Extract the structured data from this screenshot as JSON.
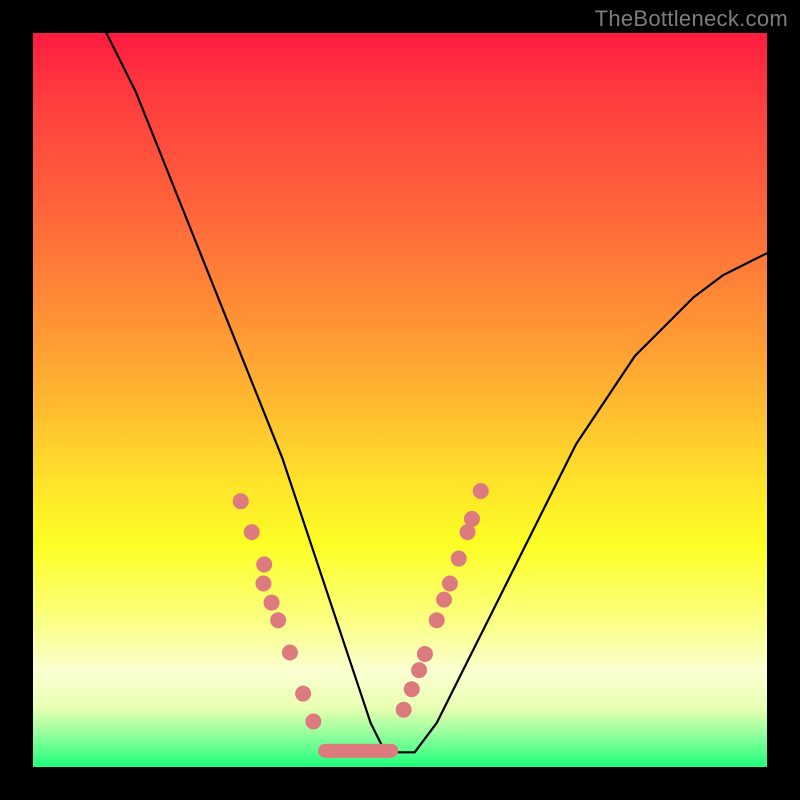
{
  "watermark": "TheBottleneck.com",
  "chart_data": {
    "type": "line",
    "title": "",
    "xlabel": "",
    "ylabel": "",
    "xlim": [
      0,
      100
    ],
    "ylim": [
      0,
      100
    ],
    "curve": {
      "name": "bottleneck-curve",
      "x": [
        10,
        14,
        18,
        22,
        26,
        30,
        34,
        36,
        38,
        40,
        42,
        44,
        46,
        48,
        52,
        55,
        58,
        62,
        66,
        70,
        74,
        78,
        82,
        86,
        90,
        94,
        98,
        100
      ],
      "y": [
        100,
        92,
        82,
        72,
        62,
        52,
        42,
        36,
        30,
        24,
        18,
        12,
        6,
        2,
        2,
        6,
        12,
        20,
        28,
        36,
        44,
        50,
        56,
        60,
        64,
        67,
        69,
        70
      ]
    },
    "markers_left": {
      "name": "left-cluster",
      "color": "#dd7a7e",
      "x": [
        28.3,
        29.8,
        31.5,
        31.4,
        32.5,
        33.4,
        35.0,
        36.8,
        38.2
      ],
      "y": [
        36.2,
        32.0,
        27.6,
        25.0,
        22.4,
        20.0,
        15.6,
        10.0,
        6.2
      ]
    },
    "markers_right": {
      "name": "right-cluster",
      "color": "#dd7a7e",
      "x": [
        50.5,
        51.6,
        52.6,
        53.4,
        55.0,
        56.0,
        56.8,
        58.0,
        59.2,
        59.8,
        61.0
      ],
      "y": [
        7.8,
        10.6,
        13.2,
        15.4,
        20.0,
        22.8,
        25.0,
        28.4,
        32.0,
        33.8,
        37.6
      ]
    },
    "flat_segment": {
      "name": "bottom-flat",
      "color": "#dd7a7e",
      "x0": 39.8,
      "x1": 48.8,
      "y": 2.2
    }
  }
}
